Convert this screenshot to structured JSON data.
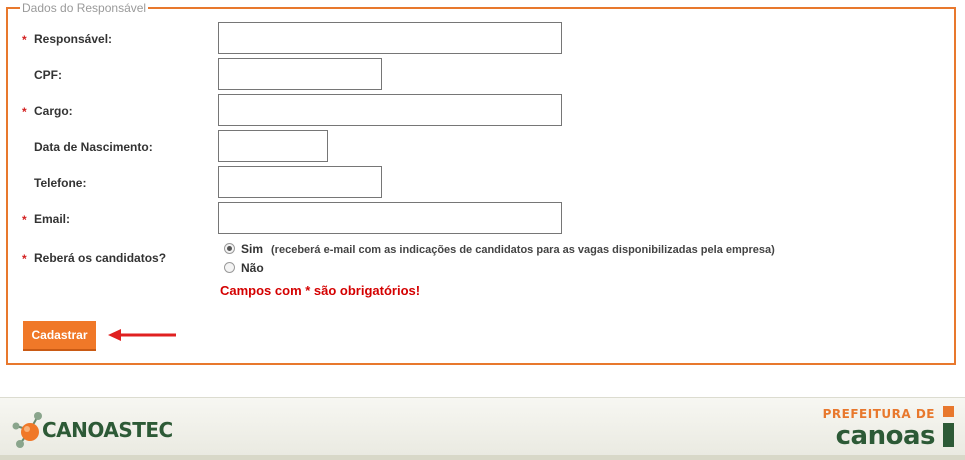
{
  "form": {
    "legend": "Dados do Responsável",
    "fields": [
      {
        "label": "Responsável:",
        "required": true,
        "value": ""
      },
      {
        "label": "CPF:",
        "required": false,
        "value": ""
      },
      {
        "label": "Cargo:",
        "required": true,
        "value": ""
      },
      {
        "label": "Data de Nascimento:",
        "required": false,
        "value": ""
      },
      {
        "label": "Telefone:",
        "required": false,
        "value": ""
      },
      {
        "label": "Email:",
        "required": true,
        "value": ""
      }
    ],
    "receive_candidates": {
      "label": "Reberá os candidatos?",
      "required": true,
      "options": [
        {
          "label": "Sim",
          "note": "(receberá e-mail com as indicações de candidatos para as vagas disponibilizadas pela empresa)",
          "selected": true
        },
        {
          "label": "Não",
          "note": "",
          "selected": false
        }
      ]
    },
    "required_note": "Campos com * são obrigatórios!",
    "submit_label": "Cadastrar",
    "required_marker": "*"
  },
  "footer": {
    "left_logo": "CANOASTEC",
    "right_logo_top": "PREFEITURA DE",
    "right_logo_bottom": "canoas"
  },
  "colors": {
    "accent": "#e8782d",
    "required": "#d32020",
    "brand_green": "#2d5a36"
  }
}
